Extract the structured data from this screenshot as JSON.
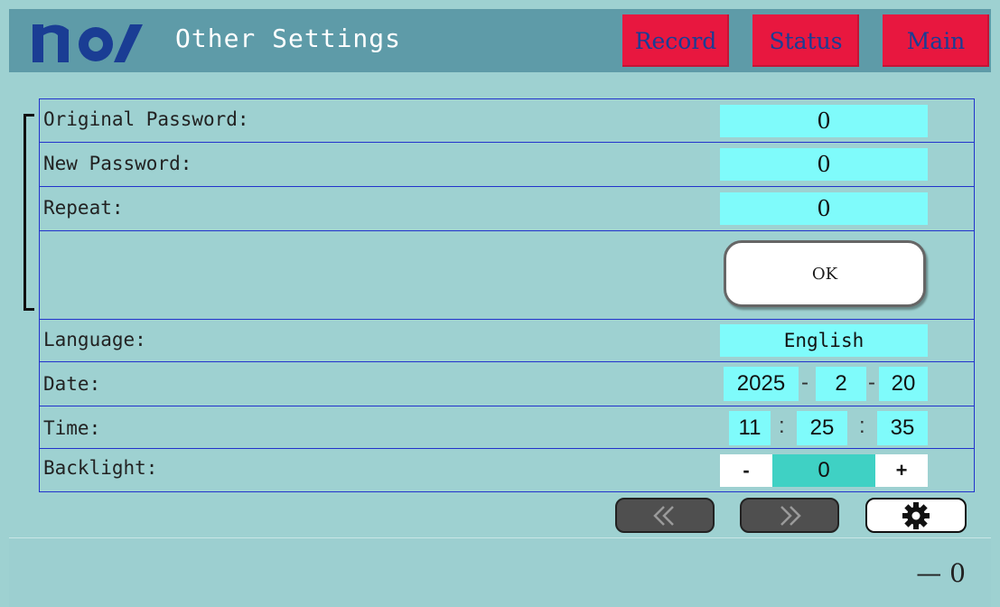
{
  "header": {
    "title": "Other Settings",
    "nav": [
      {
        "label": "Record"
      },
      {
        "label": "Status"
      },
      {
        "label": "Main"
      }
    ]
  },
  "form": {
    "original_password": {
      "label": "Original Password:",
      "value": "0"
    },
    "new_password": {
      "label": "New Password:",
      "value": "0"
    },
    "repeat": {
      "label": "Repeat:",
      "value": "0"
    },
    "ok_label": "OK",
    "language": {
      "label": "Language:",
      "value": "English"
    },
    "date": {
      "label": "Date:",
      "year": "2025",
      "month": "2",
      "day": "20",
      "separator": "-"
    },
    "time": {
      "label": "Time:",
      "hour": "11",
      "minute": "25",
      "second": "35",
      "separator": ":"
    },
    "backlight": {
      "label": "Backlight:",
      "minus": "-",
      "value": "0",
      "plus": "+"
    }
  },
  "pager": {
    "prev_icon": "double-chevron-left-icon",
    "next_icon": "double-chevron-right-icon",
    "settings_icon": "gear-icon"
  },
  "footer": {
    "value": "— 0"
  },
  "colors": {
    "header_bg": "#5e9ba8",
    "page_bg": "#9ed1d1",
    "nav_button": "#e8173f",
    "nav_text": "#1a3d94",
    "input_bg": "#7ffbfb",
    "grid_line": "#2233cc"
  }
}
